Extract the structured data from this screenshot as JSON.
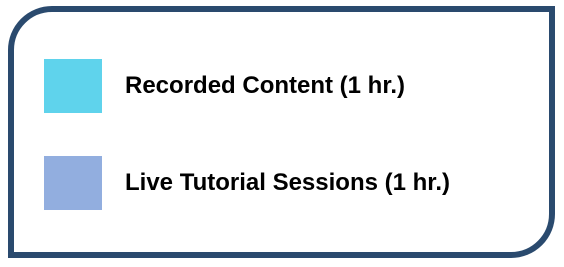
{
  "legend": {
    "items": [
      {
        "label": "Recorded Content (1 hr.)",
        "color": "#5fd3ec"
      },
      {
        "label": "Live Tutorial Sessions (1 hr.)",
        "color": "#92aedf"
      }
    ],
    "border_color": "#2a4a6e"
  }
}
